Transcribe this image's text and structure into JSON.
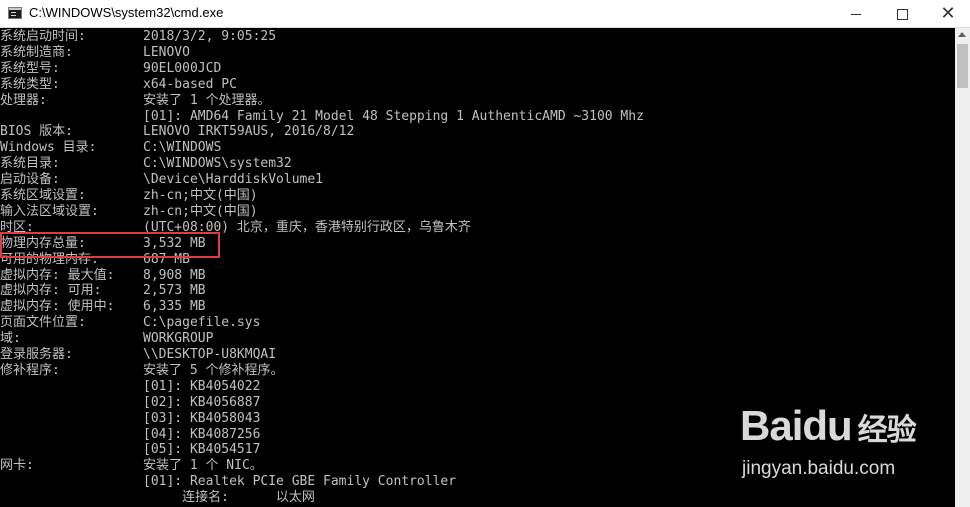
{
  "window": {
    "title": "C:\\WINDOWS\\system32\\cmd.exe",
    "minimize_icon": "minimize-icon",
    "maximize_icon": "maximize-icon",
    "close_glyph": "✕"
  },
  "console": {
    "lines": [
      {
        "label": "系统启动时间:",
        "value": "2018/3/2, 9:05:25"
      },
      {
        "label": "系统制造商:",
        "value": "LENOVO"
      },
      {
        "label": "系统型号:",
        "value": "90EL000JCD"
      },
      {
        "label": "系统类型:",
        "value": "x64-based PC"
      },
      {
        "label": "处理器:",
        "value": "安装了 1 个处理器。"
      },
      {
        "label": "",
        "value": "[01]: AMD64 Family 21 Model 48 Stepping 1 AuthenticAMD ~3100 Mhz"
      },
      {
        "label": "BIOS 版本:",
        "value": "LENOVO IRKT59AUS, 2016/8/12"
      },
      {
        "label": "Windows 目录:",
        "value": "C:\\WINDOWS"
      },
      {
        "label": "系统目录:",
        "value": "C:\\WINDOWS\\system32"
      },
      {
        "label": "启动设备:",
        "value": "\\Device\\HarddiskVolume1"
      },
      {
        "label": "系统区域设置:",
        "value": "zh-cn;中文(中国)"
      },
      {
        "label": "输入法区域设置:",
        "value": "zh-cn;中文(中国)"
      },
      {
        "label": "时区:",
        "value": "(UTC+08:00) 北京，重庆，香港特别行政区，乌鲁木齐"
      },
      {
        "label": "物理内存总量:",
        "value": "3,532 MB"
      },
      {
        "label": "可用的物理内存:",
        "value": "687 MB"
      },
      {
        "label": "虚拟内存: 最大值:",
        "value": "8,908 MB"
      },
      {
        "label": "虚拟内存: 可用:",
        "value": "2,573 MB"
      },
      {
        "label": "虚拟内存: 使用中:",
        "value": "6,335 MB"
      },
      {
        "label": "页面文件位置:",
        "value": "C:\\pagefile.sys"
      },
      {
        "label": "域:",
        "value": "WORKGROUP"
      },
      {
        "label": "登录服务器:",
        "value": "\\\\DESKTOP-U8KMQAI"
      },
      {
        "label": "修补程序:",
        "value": "安装了 5 个修补程序。"
      },
      {
        "label": "",
        "value": "[01]: KB4054022"
      },
      {
        "label": "",
        "value": "[02]: KB4056887"
      },
      {
        "label": "",
        "value": "[03]: KB4058043"
      },
      {
        "label": "",
        "value": "[04]: KB4087256"
      },
      {
        "label": "",
        "value": "[05]: KB4054517"
      },
      {
        "label": "网卡:",
        "value": "安装了 1 个 NIC。"
      },
      {
        "label": "",
        "value": "[01]: Realtek PCIe GBE Family Controller"
      },
      {
        "label": "",
        "value": "     连接名:      以太网"
      }
    ]
  },
  "watermark": {
    "logo_latin": "Bai",
    "logo_paw": "du",
    "logo_cn": "经验",
    "url": "jingyan.baidu.com"
  },
  "colors": {
    "console_bg": "#000000",
    "console_text": "#c0c0c0",
    "highlight_border": "#e03c3c"
  }
}
